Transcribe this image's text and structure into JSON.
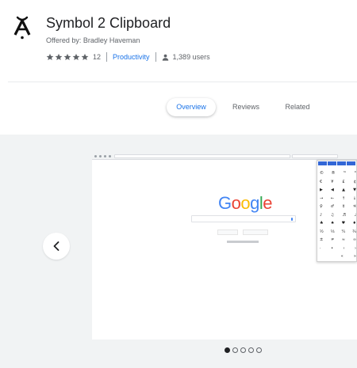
{
  "extension": {
    "icon": "a-breve-symbol-icon",
    "title": "Symbol 2 Clipboard",
    "offered_by": "Offered by: Bradley Haveman",
    "rating_stars": 5,
    "rating_count": "12",
    "category": "Productivity",
    "users": "1,389 users"
  },
  "tabs": [
    {
      "label": "Overview",
      "active": true
    },
    {
      "label": "Reviews",
      "active": false
    },
    {
      "label": "Related",
      "active": false
    }
  ],
  "gallery": {
    "prev_icon": "chevron-left-icon",
    "screenshot_logo": "Google",
    "dots_total": 5,
    "dots_active_index": 0
  },
  "colors": {
    "accent": "#1a73e8",
    "text_primary": "#202124",
    "text_secondary": "#5f6368",
    "gallery_bg": "#f1f3f4"
  }
}
